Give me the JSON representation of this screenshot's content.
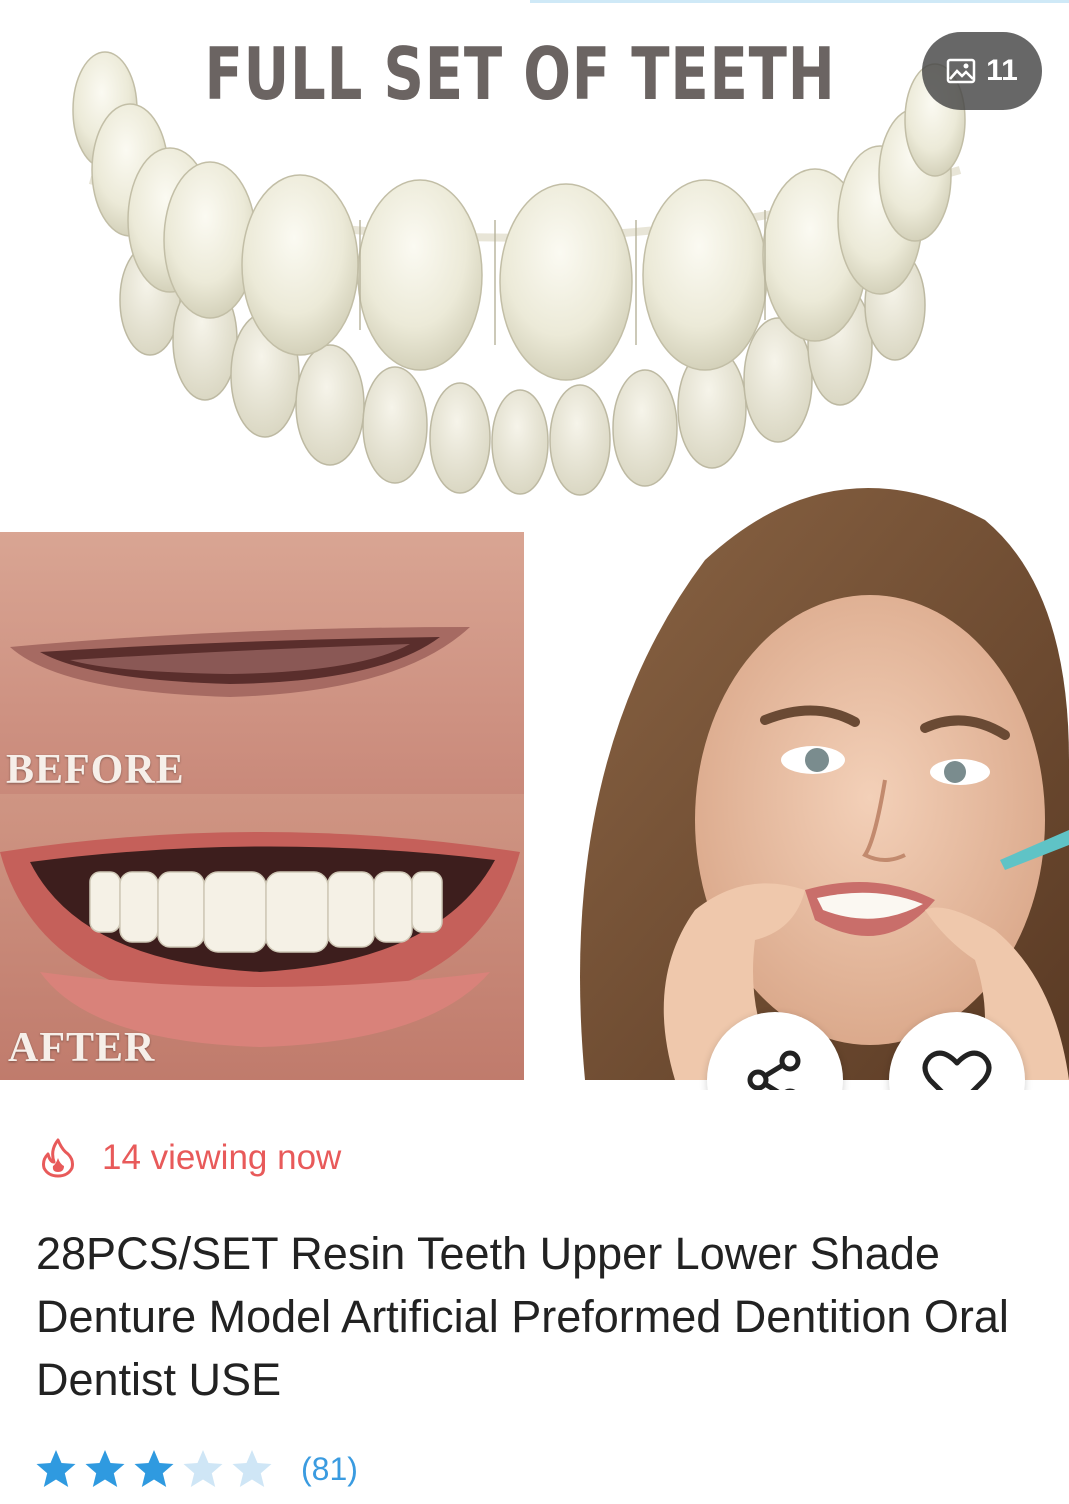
{
  "hero": {
    "image_counter": "11",
    "image_counter_icon": "image-icon",
    "promo_title": "FULL SET OF TEETH",
    "before_label": "BEFORE",
    "after_label": "AFTER"
  },
  "actions": {
    "share_icon": "share-icon",
    "wishlist_icon": "heart-icon"
  },
  "product": {
    "viewing_icon": "flame-icon",
    "viewing_text": "14 viewing now",
    "title": "28PCS/SET Resin Teeth Upper Lower Shade Denture Model Artificial Preformed Dentition Oral Dentist USE",
    "rating": 3,
    "rating_max": 5,
    "review_count": "(81)"
  },
  "colors": {
    "viewing_red": "#e85a5a",
    "star_filled": "#2f9ae0",
    "star_empty": "#cfe6f6",
    "link_blue": "#3a9be0"
  }
}
